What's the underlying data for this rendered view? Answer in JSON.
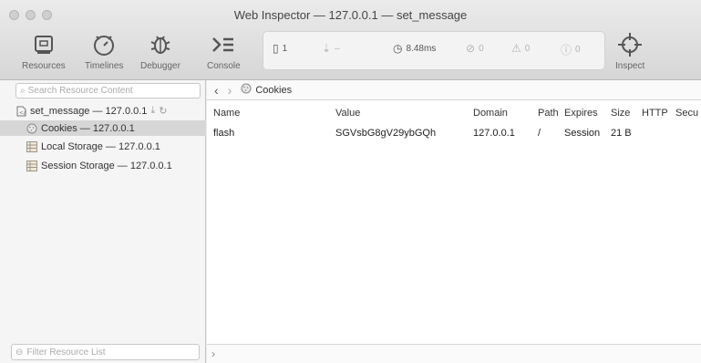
{
  "window": {
    "title": "Web Inspector — 127.0.0.1 — set_message"
  },
  "toolbar": {
    "resources": "Resources",
    "timelines": "Timelines",
    "debugger": "Debugger",
    "console": "Console",
    "inspect": "Inspect"
  },
  "status": {
    "resource_count": "1",
    "size": "–",
    "load_time": "8.48ms",
    "errors": "0",
    "warnings": "0",
    "logs": "0"
  },
  "sidebar": {
    "search_placeholder": "Search Resource Content",
    "items": [
      {
        "label": "set_message — 127.0.0.1"
      },
      {
        "label": "Cookies — 127.0.0.1"
      },
      {
        "label": "Local Storage — 127.0.0.1"
      },
      {
        "label": "Session Storage — 127.0.0.1"
      }
    ],
    "filter_placeholder": "Filter Resource List"
  },
  "main": {
    "breadcrumb": "Cookies",
    "columns": [
      "Name",
      "Value",
      "Domain",
      "Path",
      "Expires",
      "Size",
      "HTTP",
      "Secu"
    ],
    "rows": [
      [
        "flash",
        "SGVsbG8gV29ybGQh",
        "127.0.0.1",
        "/",
        "Session",
        "21 B",
        "",
        ""
      ]
    ],
    "console_prompt": "›"
  }
}
